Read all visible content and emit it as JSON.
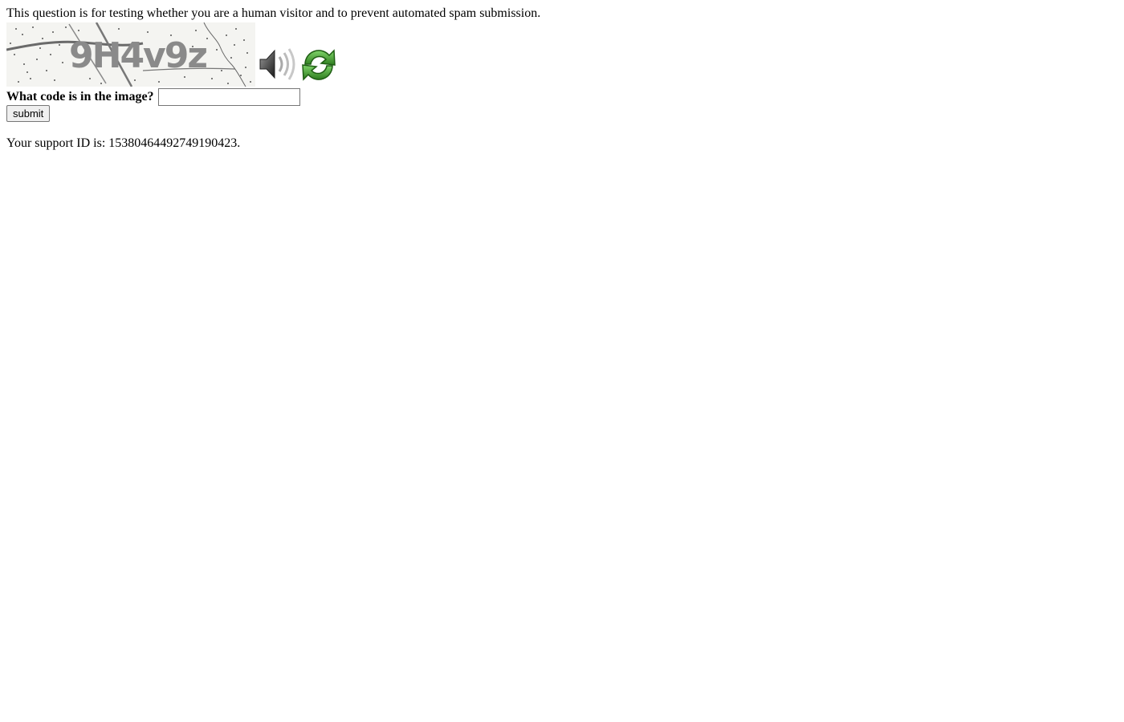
{
  "intro_text": "This question is for testing whether you are a human visitor and to prevent automated spam submission.",
  "captcha": {
    "code_text": "9H4v9z",
    "audio_icon": "speaker-icon",
    "refresh_icon": "refresh-icon",
    "refresh_color": "#3c9a2e"
  },
  "form": {
    "question_label": "What code is in the image?",
    "input_value": "",
    "submit_label": "submit"
  },
  "support": {
    "prefix": "Your support ID is: ",
    "id": "15380464492749190423",
    "suffix": "."
  }
}
